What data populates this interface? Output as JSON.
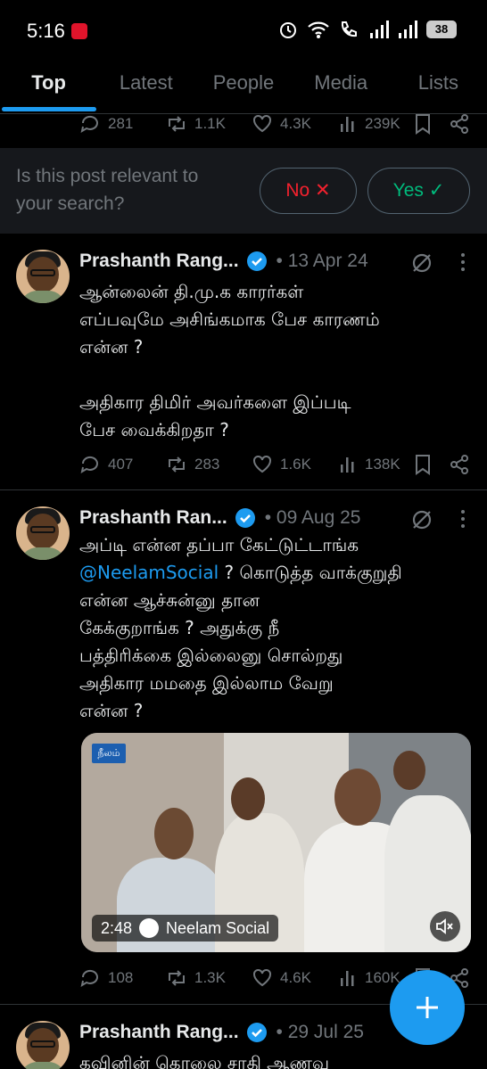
{
  "status_bar": {
    "time": "5:16",
    "battery": "38"
  },
  "tabs": [
    {
      "label": "Top",
      "active": true
    },
    {
      "label": "Latest"
    },
    {
      "label": "People"
    },
    {
      "label": "Media"
    },
    {
      "label": "Lists"
    }
  ],
  "top_actions": {
    "replies": "281",
    "reposts": "1.1K",
    "likes": "4.3K",
    "views": "239K"
  },
  "relevance_prompt": {
    "question": "Is this post relevant to your search?",
    "no_label": "No ✕",
    "yes_label": "Yes ✓"
  },
  "posts": [
    {
      "author": "Prashanth Rang...",
      "date": "• 13 Apr 24",
      "lines": [
        "ஆன்லைன் தி.மு.க காரர்கள்",
        "எப்பவுமே அசிங்கமாக பேச காரணம்",
        "என்ன ?",
        "",
        "அதிகார திமிர் அவர்களை இப்படி",
        "பேச வைக்கிறதா ?"
      ],
      "replies": "407",
      "reposts": "283",
      "likes": "1.6K",
      "views": "138K"
    },
    {
      "author": "Prashanth Ran...",
      "date": "• 09 Aug 25",
      "line1": "அப்டி என்ன தப்பா கேட்டுட்டாங்க",
      "mention": "@NeelamSocial",
      "line2_rest": " ? கொடுத்த வாக்குறுதி",
      "lines_after": [
        "என்ன ஆச்சுன்னு தான",
        "கேக்குறாங்க ? அதுக்கு நீ",
        "பத்திரிக்கை இல்லைனு சொல்றது",
        "அதிகார மமதை இல்லாம வேறு",
        "என்ன ?"
      ],
      "media": {
        "logo_text": "நீலம்",
        "duration": "2:48",
        "channel": "Neelam Social"
      },
      "replies": "108",
      "reposts": "1.3K",
      "likes": "4.6K",
      "views": "160K"
    },
    {
      "author": "Prashanth Rang...",
      "date": "• 29 Jul 25",
      "lines": [
        "கவினின் கொலை சாதி ஆணவ"
      ]
    }
  ]
}
